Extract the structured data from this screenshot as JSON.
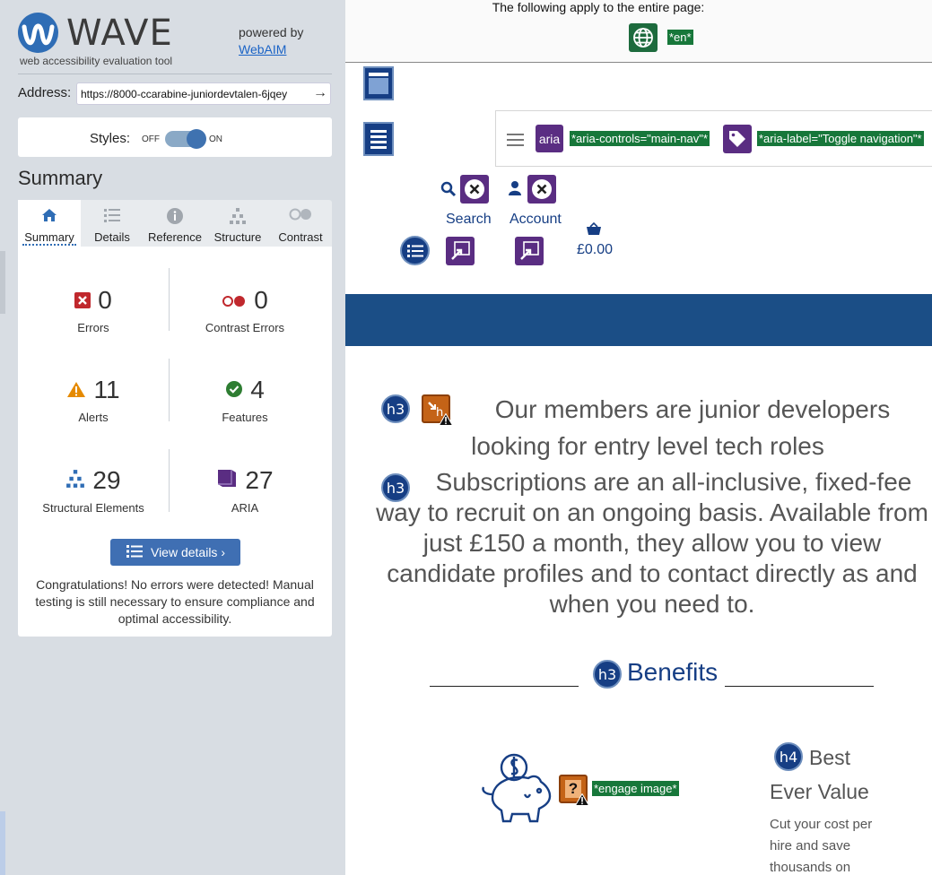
{
  "wave": {
    "logo_text": "WAVE",
    "tagline": "web accessibility evaluation tool",
    "powered_by": "powered by",
    "webaim_link": "WebAIM",
    "address_label": "Address:",
    "address_value": "https://8000-ccarabine-juniordevtalen-6jqey",
    "styles_label": "Styles:",
    "styles_off": "OFF",
    "styles_on": "ON",
    "summary_heading": "Summary",
    "tabs": [
      {
        "label": "Summary",
        "icon": "home-icon",
        "active": true
      },
      {
        "label": "Details",
        "icon": "list-icon",
        "active": false
      },
      {
        "label": "Reference",
        "icon": "info-icon",
        "active": false
      },
      {
        "label": "Structure",
        "icon": "structure-icon",
        "active": false
      },
      {
        "label": "Contrast",
        "icon": "contrast-icon",
        "active": false
      }
    ],
    "stats": {
      "errors": {
        "count": "0",
        "label": "Errors"
      },
      "contrast_errors": {
        "count": "0",
        "label": "Contrast Errors"
      },
      "alerts": {
        "count": "11",
        "label": "Alerts"
      },
      "features": {
        "count": "4",
        "label": "Features"
      },
      "structural": {
        "count": "29",
        "label": "Structural Elements"
      },
      "aria": {
        "count": "27",
        "label": "ARIA"
      }
    },
    "view_details_label": "View details ›",
    "congrats": "Congratulations! No errors were detected! Manual testing is still necessary to ensure compliance and optimal accessibility."
  },
  "page": {
    "topbar_text": "The following apply to the entire page:",
    "lang_tag": "*en*",
    "aria_badge": "aria",
    "aria_controls_tag": "*aria-controls=\"main-nav\"*",
    "aria_label_tag": "*aria-label=\"Toggle navigation\"*",
    "search_label": "Search",
    "account_label": "Account",
    "basket_value": "£0.00",
    "h3_label": "h3",
    "h4_label": "h4",
    "heading1": "Our members are junior developers looking for entry level tech roles",
    "heading2": "Subscriptions are an all-inclusive, fixed-fee way to recruit on an ongoing basis. Available from just £150 a month, they allow you to view candidate profiles and to contact directly as and when you need to.",
    "benefits": "Benefits",
    "engage_tag": "*engage image*",
    "best_value": "Best Ever Value",
    "best_value_desc": "Cut your cost per hire and save thousands on"
  },
  "colors": {
    "wave_blue": "#2f6db5",
    "error_red": "#c0282d",
    "alert_orange": "#e58a00",
    "feature_green": "#2e7d32",
    "aria_purple": "#5a2d82",
    "tag_green": "#17773a",
    "page_band": "#1b4e86"
  }
}
